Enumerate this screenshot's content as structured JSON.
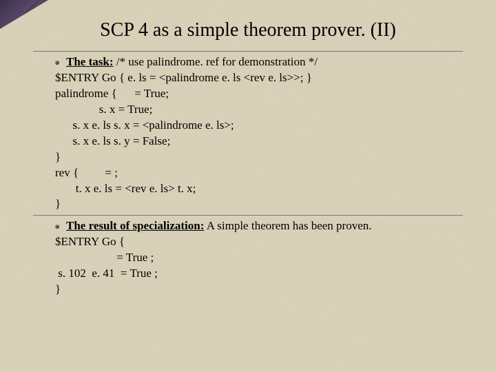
{
  "title": "SCP 4 as a simple theorem prover. (II)",
  "task": {
    "label": "The task:",
    "comment": "/* use palindrome. ref for demonstration */",
    "lines": [
      "$ENTRY Go { e. ls = <palindrome e. ls <rev e. ls>>; }",
      "palindrome {      = True;",
      "               s. x = True;",
      "      s. x e. ls s. x = <palindrome e. ls>;",
      "      s. x e. ls s. y = False;",
      "}",
      "rev {         = ;",
      "       t. x e. ls = <rev e. ls> t. x;",
      "}"
    ]
  },
  "result": {
    "label": "The result of specialization:",
    "text": "A simple theorem has been proven.",
    "lines": [
      "$ENTRY Go {",
      "                     = True ;",
      " s. 102  e. 41  = True ;",
      "}"
    ]
  }
}
